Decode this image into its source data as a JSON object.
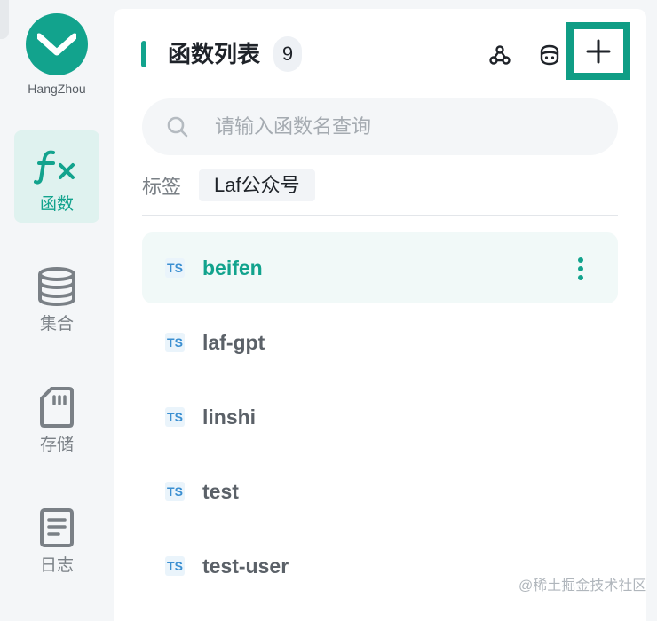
{
  "sidebar": {
    "region": "HangZhou",
    "items": [
      {
        "label": "函数",
        "icon": "function-icon",
        "active": true
      },
      {
        "label": "集合",
        "icon": "database-icon",
        "active": false
      },
      {
        "label": "存储",
        "icon": "storage-card-icon",
        "active": false
      },
      {
        "label": "日志",
        "icon": "log-document-icon",
        "active": false
      }
    ]
  },
  "panel": {
    "title": "函数列表",
    "count": "9",
    "toolbar": [
      "webhook-icon",
      "ai-robot-icon",
      "plus-icon"
    ],
    "search": {
      "placeholder": "请输入函数名查询",
      "value": ""
    },
    "tags": {
      "label": "标签",
      "items": [
        "Laf公众号"
      ]
    },
    "functions": [
      {
        "lang": "TS",
        "name": "beifen",
        "active": true
      },
      {
        "lang": "TS",
        "name": "laf-gpt",
        "active": false
      },
      {
        "lang": "TS",
        "name": "linshi",
        "active": false
      },
      {
        "lang": "TS",
        "name": "test",
        "active": false
      },
      {
        "lang": "TS",
        "name": "test-user",
        "active": false
      }
    ]
  },
  "watermark": "@稀土掘金技术社区",
  "colors": {
    "accent": "#12a38d",
    "highlight_border": "#0f9d85",
    "ts_badge": "#3b8fd1"
  }
}
